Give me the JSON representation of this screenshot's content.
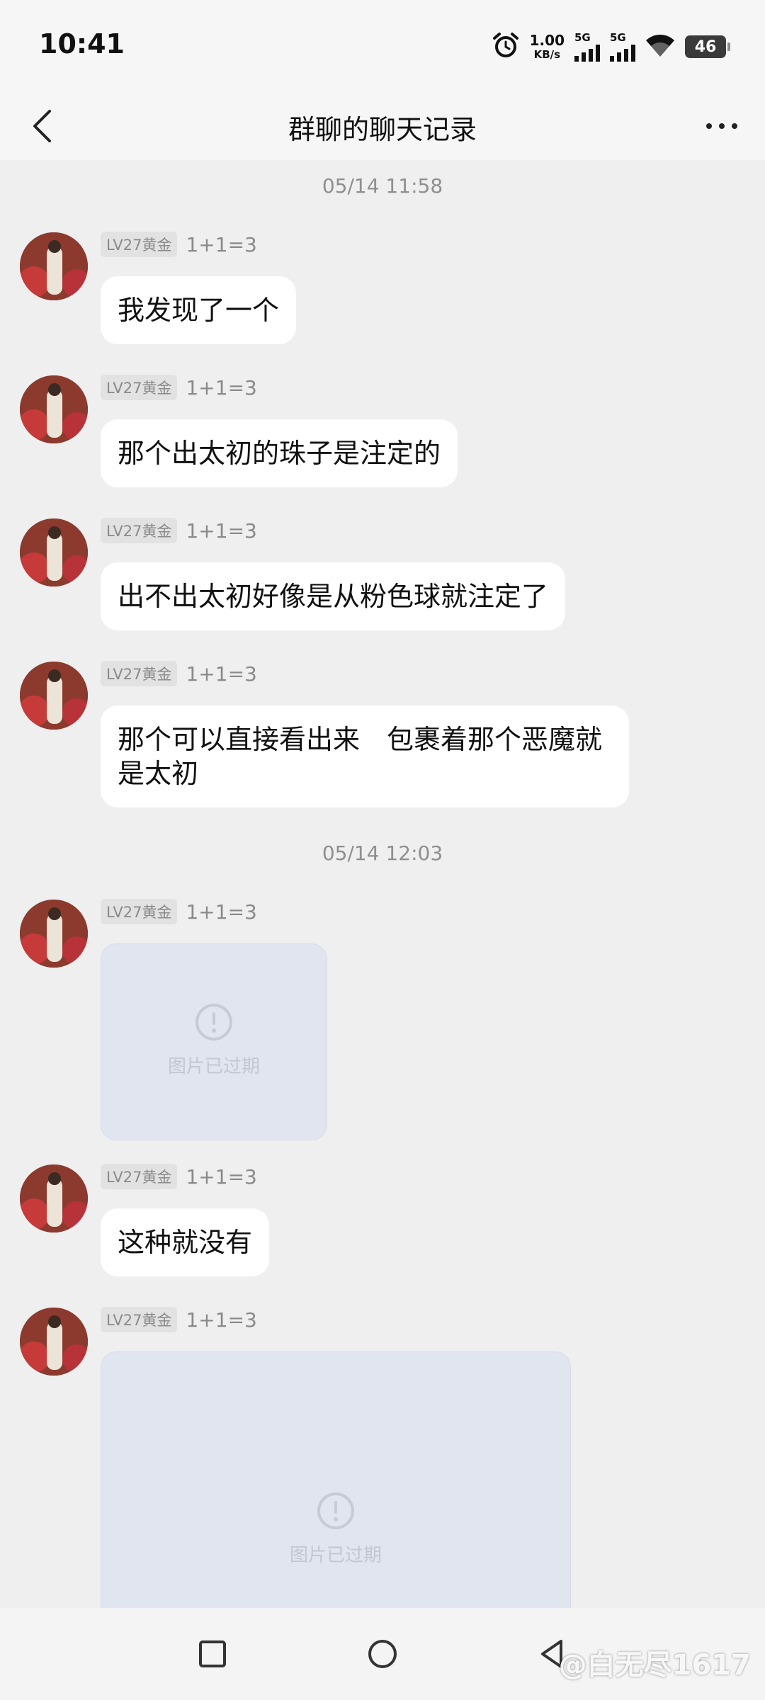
{
  "status_bar": {
    "time": "10:41",
    "net_speed_value": "1.00",
    "net_speed_unit": "KB/s",
    "sim1_label": "5G",
    "sim2_label": "5G",
    "battery_level": "46"
  },
  "header": {
    "title": "群聊的聊天记录"
  },
  "chat": {
    "timestamps": [
      "05/14 11:58",
      "05/14 12:03"
    ],
    "messages": [
      {
        "level": "LV27黄金",
        "nickname": "1+1=3",
        "text": "我发现了一个"
      },
      {
        "level": "LV27黄金",
        "nickname": "1+1=3",
        "text": "那个出太初的珠子是注定的"
      },
      {
        "level": "LV27黄金",
        "nickname": "1+1=3",
        "text": "出不出太初好像是从粉色球就注定了"
      },
      {
        "level": "LV27黄金",
        "nickname": "1+1=3",
        "text": "那个可以直接看出来　包裹着那个恶魔就是太初"
      },
      {
        "level": "LV27黄金",
        "nickname": "1+1=3",
        "image_text": "图片已过期"
      },
      {
        "level": "LV27黄金",
        "nickname": "1+1=3",
        "text": "这种就没有"
      },
      {
        "level": "LV27黄金",
        "nickname": "1+1=3",
        "image_text": "图片已过期"
      }
    ]
  },
  "watermark": "@白无尽1617",
  "colors": {
    "background": "#efefef",
    "bubble": "#ffffff",
    "image_placeholder": "#e1e5ef",
    "meta_text": "#8a8a8a"
  }
}
